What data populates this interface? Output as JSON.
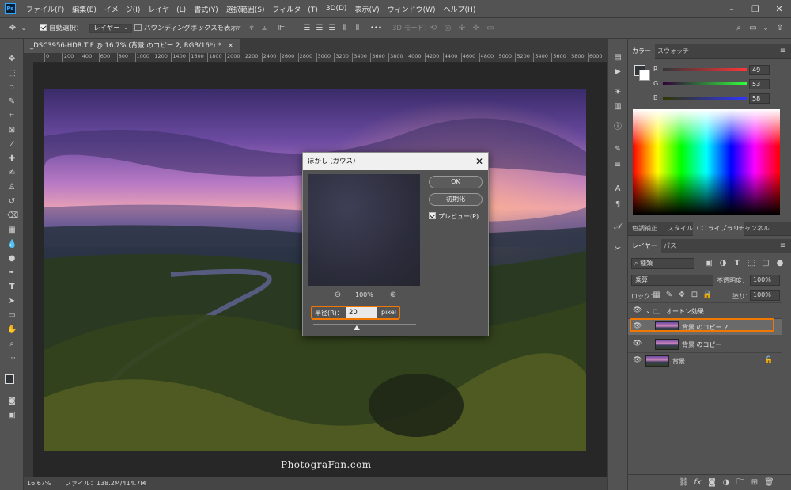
{
  "app": {
    "logo": "Ps"
  },
  "menu": [
    "ファイル(F)",
    "編集(E)",
    "イメージ(I)",
    "レイヤー(L)",
    "書式(Y)",
    "選択範囲(S)",
    "フィルター(T)",
    "3D(D)",
    "表示(V)",
    "ウィンドウ(W)",
    "ヘルプ(H)"
  ],
  "options": {
    "auto_select_label": "自動選択：",
    "auto_select_value": "レイヤー",
    "bounding_box_label": "バウンディングボックスを表示",
    "mode_3d": "3D モード：",
    "more": "•••"
  },
  "document": {
    "tab_title": "_DSC3956-HDR.TIF @ 16.7% (背景 のコピー 2, RGB/16*) *",
    "tab_close": "×",
    "ruler_ticks": [
      "0",
      "200",
      "400",
      "600",
      "800",
      "1000",
      "1200",
      "1400",
      "1600",
      "1800",
      "2000",
      "2200",
      "2400",
      "2600",
      "2800",
      "3000",
      "3200",
      "3400",
      "3600",
      "3800",
      "4000",
      "4200",
      "4400",
      "4600",
      "4800",
      "5000",
      "5200",
      "5400",
      "5600",
      "5800",
      "6000"
    ],
    "watermark": "PhotograFan.com"
  },
  "status": {
    "zoom": "16.67%",
    "file": "ファイル：138.2M/414.7M",
    "arrow": "›"
  },
  "dialog": {
    "title": "ぼかし (ガウス)",
    "close": "✕",
    "ok": "OK",
    "reset": "初期化",
    "preview_label": "プレビュー(P)",
    "zoom": "100%",
    "radius_label": "半径(R)：",
    "radius_value": "20",
    "radius_unit": "pixel",
    "radius_slider_fraction": 0.42
  },
  "color_panel": {
    "tabs": [
      "カラー",
      "スウォッチ"
    ],
    "r_label": "R",
    "r_value": "49",
    "g_label": "G",
    "g_value": "53",
    "b_label": "B",
    "b_value": "58",
    "foreground": "#31353a"
  },
  "mid_tabs": [
    "色調補正",
    "スタイル",
    "CC ライブラリ",
    "チャンネル"
  ],
  "layers_panel": {
    "tabs": [
      "レイヤー",
      "パス"
    ],
    "kind": "種類",
    "blend": "乗算",
    "opacity_label": "不透明度：",
    "opacity_value": "100%",
    "lock_label": "ロック：",
    "fill_label": "塗り：",
    "fill_value": "100%",
    "group_name": "オートン効果",
    "layers": [
      {
        "name": "背景 のコピー 2"
      },
      {
        "name": "背景 のコピー"
      },
      {
        "name": "背景"
      }
    ],
    "footer_icons": [
      "link-icon",
      "fx-icon",
      "mask-icon",
      "adjustment-icon",
      "folder-icon",
      "new-layer-icon",
      "trash-icon"
    ]
  },
  "colors": {
    "accent": "#f07800",
    "panel": "#535353",
    "dark": "#3a3a3a"
  }
}
